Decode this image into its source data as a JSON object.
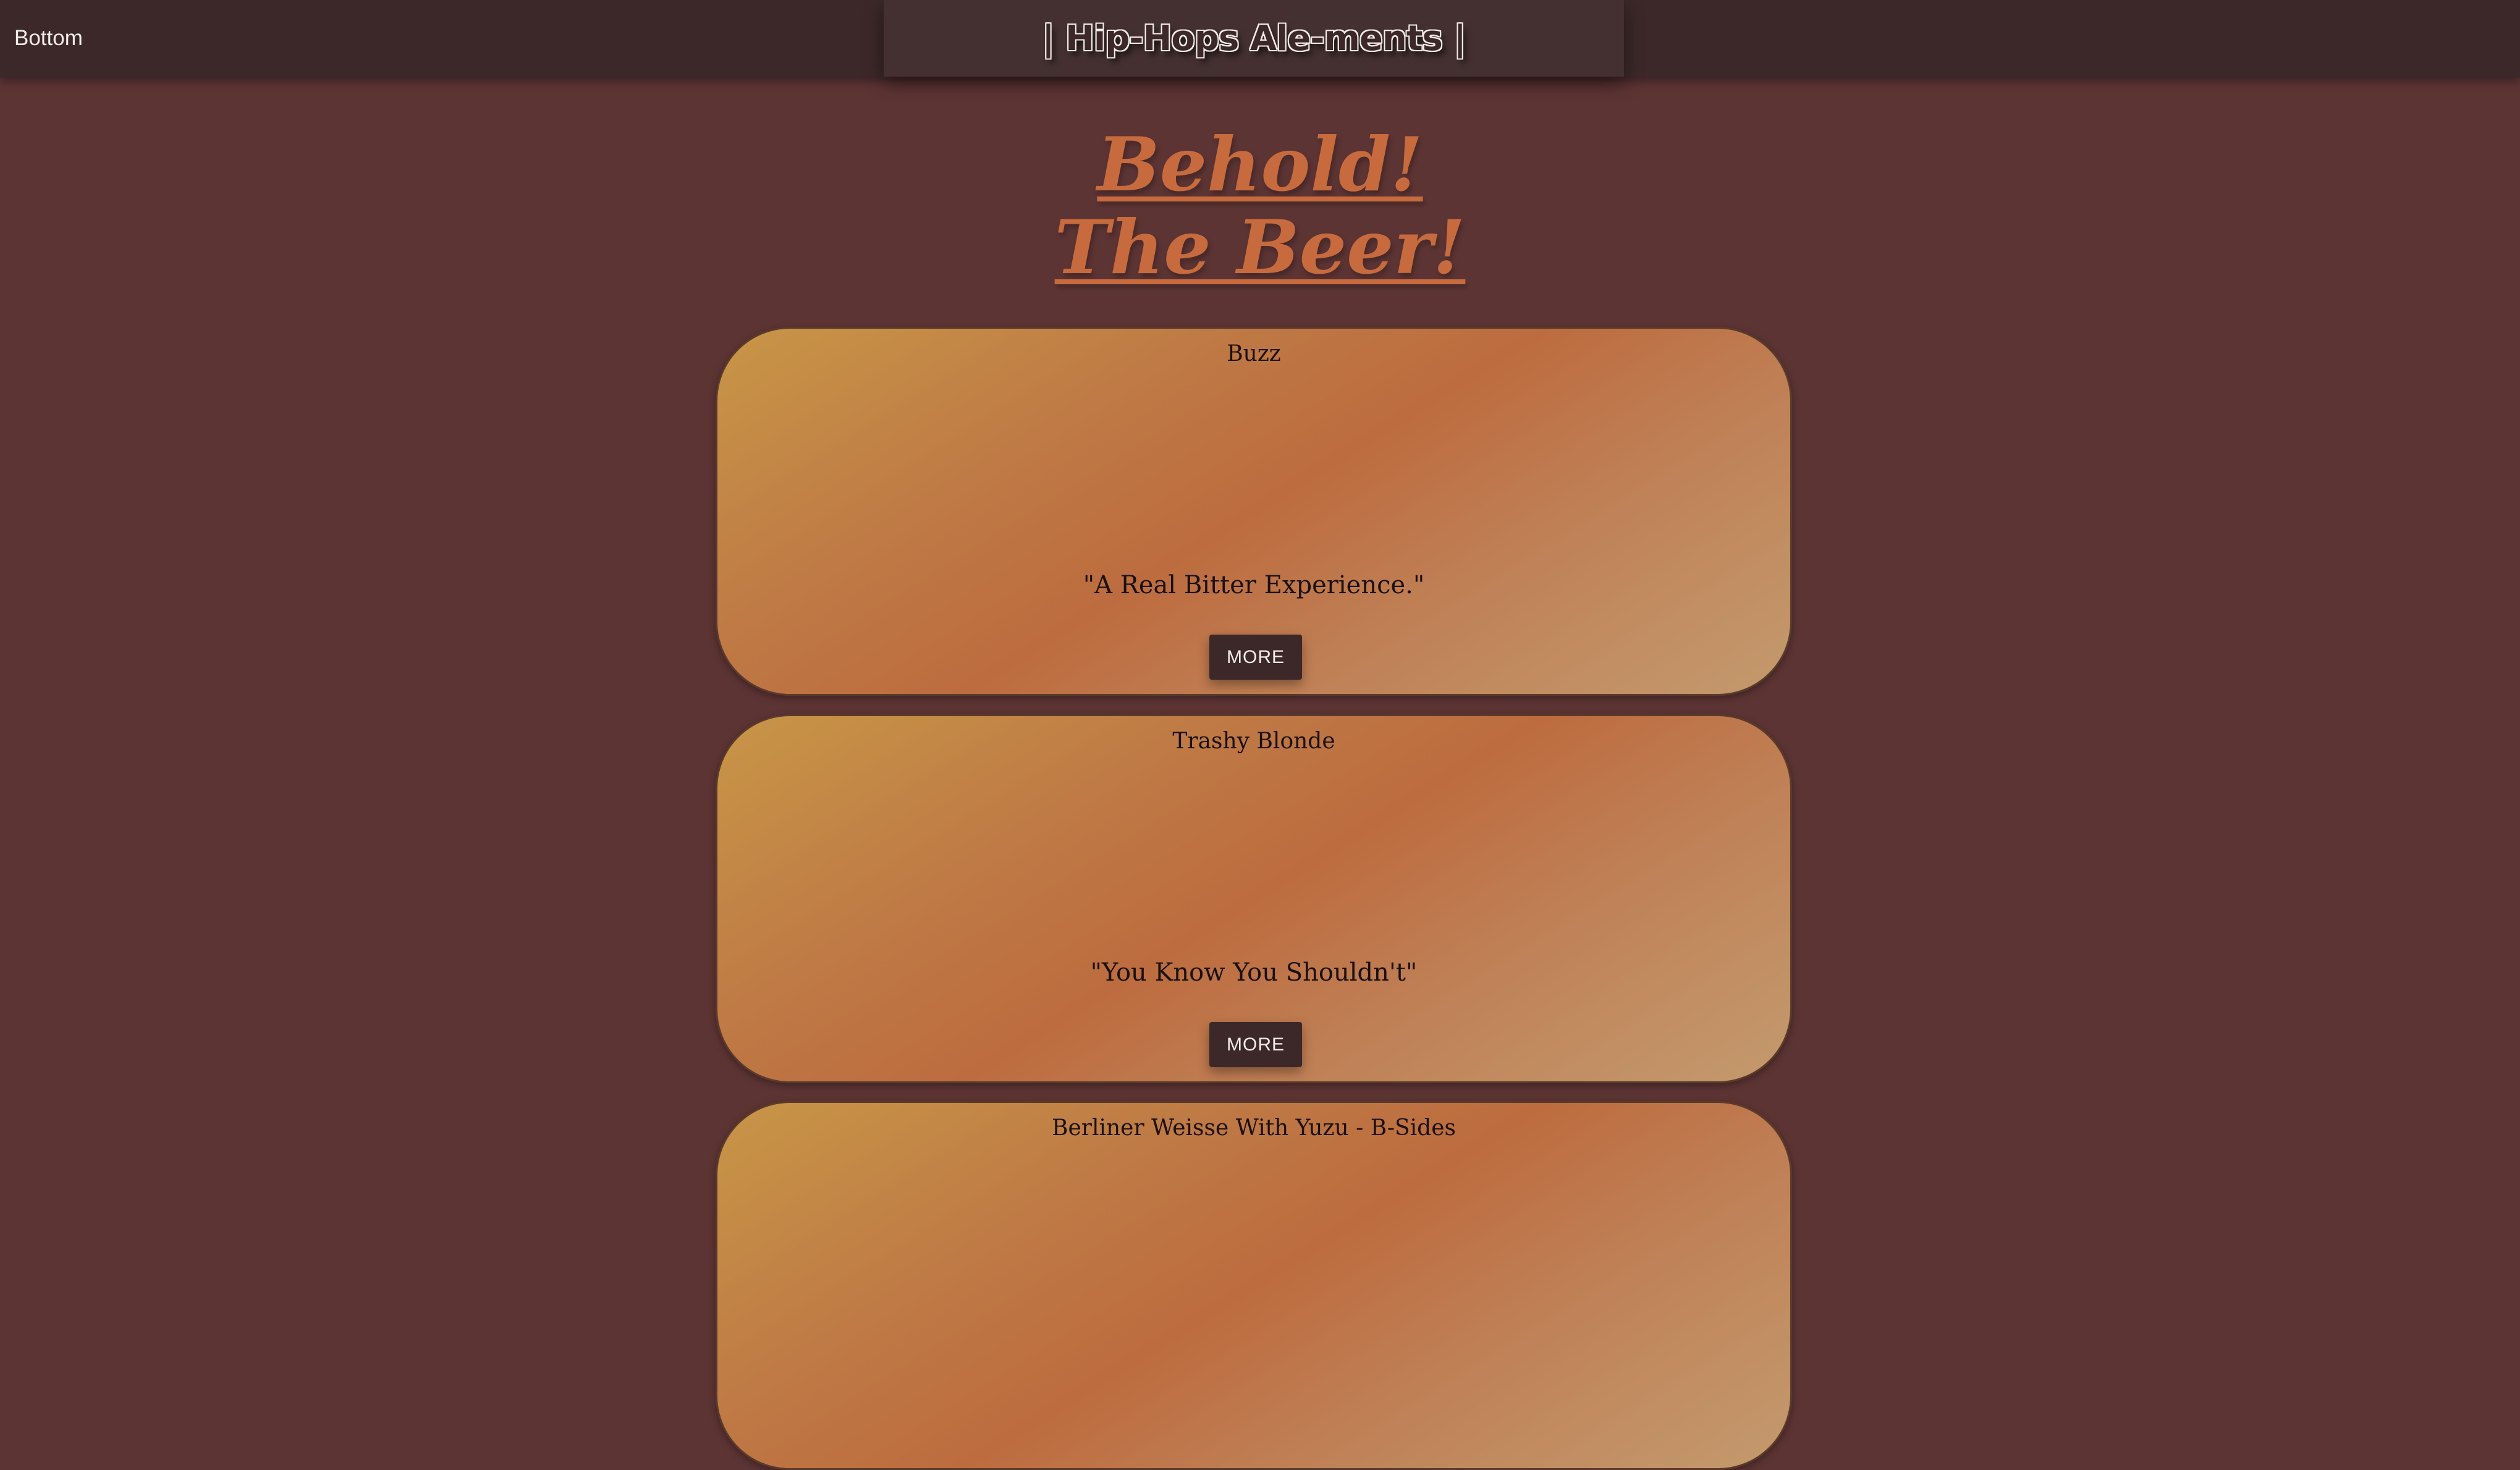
{
  "nav": {
    "bottom_link": "Bottom",
    "brand": "| Hip-Hops Ale-ments |"
  },
  "hero": {
    "line1": "Behold!",
    "line2": "The Beer!"
  },
  "beers": [
    {
      "name": "Buzz",
      "tagline": "\"A Real Bitter Experience.\"",
      "button": "MORE"
    },
    {
      "name": "Trashy Blonde",
      "tagline": "\"You Know You Shouldn't\"",
      "button": "MORE"
    },
    {
      "name": "Berliner Weisse With Yuzu - B-Sides"
    }
  ],
  "colors": {
    "page_background": "#5d3434",
    "topbar": "#3c2828",
    "hero_text": "#c76b3e",
    "button": "#3c2828"
  }
}
